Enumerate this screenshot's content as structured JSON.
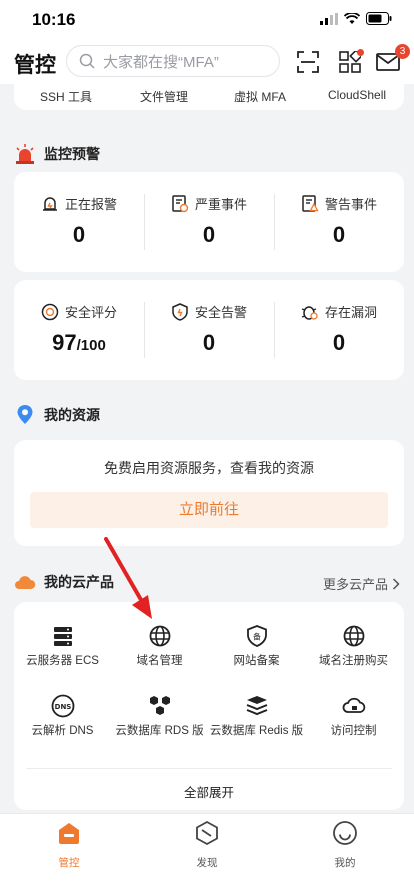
{
  "status_bar": {
    "time": "10:16"
  },
  "header": {
    "title": "管控",
    "search_placeholder": "大家都在搜“MFA”",
    "mail_badge": "3"
  },
  "quick_links": [
    "SSH 工具",
    "文件管理",
    "虚拟 MFA",
    "CloudShell"
  ],
  "monitor": {
    "title": "监控预警",
    "row1": [
      {
        "label": "正在报警",
        "value": "0",
        "icon": "alarm-bell-icon"
      },
      {
        "label": "严重事件",
        "value": "0",
        "icon": "severe-event-icon"
      },
      {
        "label": "警告事件",
        "value": "0",
        "icon": "warning-event-icon"
      }
    ],
    "row2": [
      {
        "label": "安全评分",
        "value": "97",
        "suffix": "/100",
        "icon": "security-score-icon"
      },
      {
        "label": "安全告警",
        "value": "0",
        "icon": "security-alert-icon"
      },
      {
        "label": "存在漏洞",
        "value": "0",
        "icon": "vulnerability-icon"
      }
    ]
  },
  "resources": {
    "title": "我的资源",
    "message": "免费启用资源服务，查看我的资源",
    "button": "立即前往"
  },
  "products": {
    "title": "我的云产品",
    "more": "更多云产品",
    "items": [
      {
        "label": "云服务器 ECS",
        "icon": "server-icon"
      },
      {
        "label": "域名管理",
        "icon": "globe-icon"
      },
      {
        "label": "网站备案",
        "icon": "record-shield-icon"
      },
      {
        "label": "域名注册购买",
        "icon": "globe-icon"
      },
      {
        "label": "云解析 DNS",
        "icon": "dns-icon"
      },
      {
        "label": "云数据库 RDS 版",
        "icon": "database-hex-icon"
      },
      {
        "label": "云数据库 Redis 版",
        "icon": "redis-stack-icon"
      },
      {
        "label": "访问控制",
        "icon": "cloud-access-icon"
      }
    ],
    "expand": "全部展开"
  },
  "tabbar": [
    {
      "label": "管控",
      "active": true
    },
    {
      "label": "发现",
      "active": false
    },
    {
      "label": "我的",
      "active": false
    }
  ],
  "colors": {
    "accent": "#ed7a2f",
    "badge": "#e8442e",
    "background": "#f2f3f5",
    "arrow": "#e22222"
  }
}
